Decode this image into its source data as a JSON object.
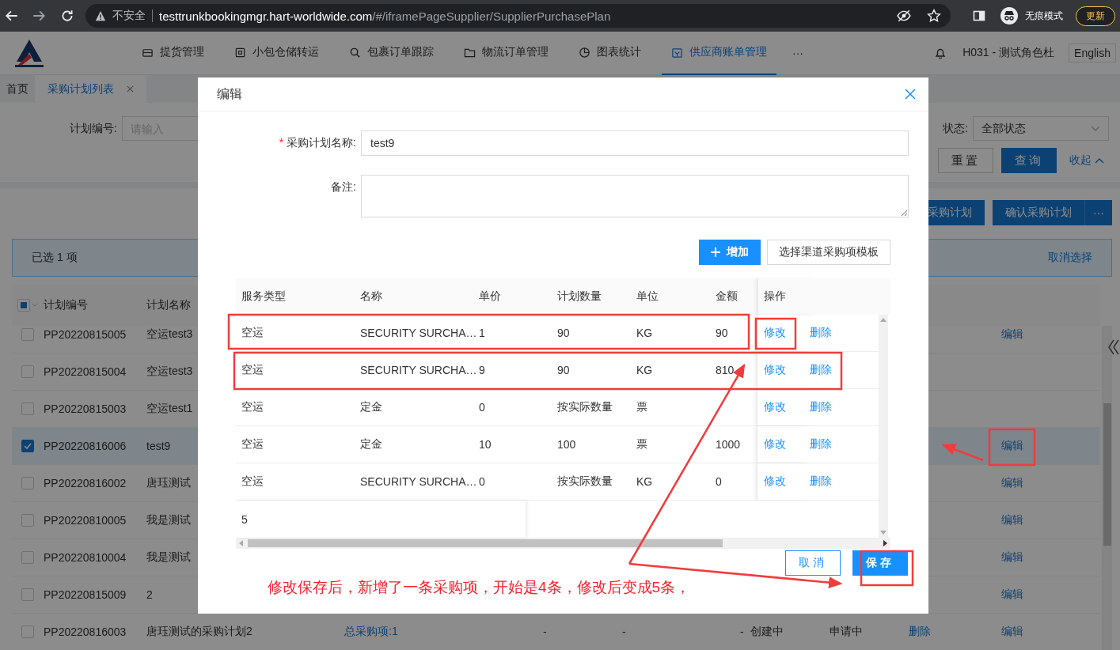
{
  "browser": {
    "security": "不安全",
    "url_host": "testtrunkbookingmgr.hart-worldwide.com",
    "url_path": "/#/iframePageSupplier/SupplierPurchasePlan",
    "profile": "无痕模式",
    "update_button": "更新"
  },
  "nav": {
    "items": [
      {
        "label": "提货管理",
        "selected": false
      },
      {
        "label": "小包仓储转运",
        "selected": false
      },
      {
        "label": "包裹订单跟踪",
        "selected": false
      },
      {
        "label": "物流订单管理",
        "selected": false
      },
      {
        "label": "图表统计",
        "selected": false
      },
      {
        "label": "供应商账单管理",
        "selected": true
      }
    ],
    "more": "···",
    "user": "H031 - 测试角色杜",
    "language": "English"
  },
  "tabs": [
    {
      "label": "首页",
      "selected": false,
      "closable": false
    },
    {
      "label": "采购计划列表",
      "selected": true,
      "closable": true
    }
  ],
  "filters": {
    "plan_no_label": "计划编号:",
    "plan_no_placeholder": "请输入",
    "status_label": "状态:",
    "status_value": "全部状态",
    "reset": "重置",
    "search": "查询",
    "collapse": "收起"
  },
  "actions": {
    "create": "采购计划",
    "confirm": "确认采购计划",
    "more": "···"
  },
  "selection": {
    "text": "已选 1 项",
    "clear": "取消选择"
  },
  "table": {
    "header_indeterminate": true,
    "columns": [
      "计划编号",
      "计划名称"
    ],
    "rows": [
      {
        "selected": false,
        "plan_no": "PP20220815005",
        "plan_name": "空运test3",
        "column_11": "编辑"
      },
      {
        "selected": false,
        "plan_no": "PP20220815004",
        "plan_name": "空运test3"
      },
      {
        "selected": false,
        "plan_no": "PP20220815003",
        "plan_name": "空运test1"
      },
      {
        "selected": true,
        "plan_no": "PP20220816006",
        "plan_name": "test9",
        "column_11": "编辑"
      },
      {
        "selected": false,
        "plan_no": "PP20220816002",
        "plan_name": "唐珏测试",
        "column_11": "编辑"
      },
      {
        "selected": false,
        "plan_no": "PP20220810005",
        "plan_name": "我是测试",
        "column_11": "编辑"
      },
      {
        "selected": false,
        "plan_no": "PP20220810004",
        "plan_name": "我是测试",
        "column_11": "编辑"
      },
      {
        "selected": false,
        "plan_no": "PP20220815009",
        "plan_name": "2",
        "column_11": "编辑"
      },
      {
        "selected": false,
        "plan_no": "PP20220816003",
        "plan_name": "唐珏测试的采购计划2",
        "column_4": "总采购项:1",
        "column_5": "-",
        "column_6": "-",
        "column_7": "-",
        "column_8": "创建中",
        "column_9": "申请中",
        "column_10": "删除",
        "column_11": "编辑"
      }
    ]
  },
  "modal": {
    "title": "编辑",
    "name_label": "采购计划名称:",
    "required_mark": "*",
    "name_value": "test9",
    "remark_label": "备注:",
    "add_button": "增加",
    "template_button": "选择渠道采购项模板",
    "columns": [
      "服务类型",
      "名称",
      "单价",
      "计划数量",
      "单位",
      "金额",
      "操作"
    ],
    "items": [
      {
        "service": "空运",
        "name": "SECURITY SURCHA…",
        "price": "1",
        "qty": "90",
        "unit": "KG",
        "amount": "90",
        "edit": "修改",
        "delete": "删除"
      },
      {
        "service": "空运",
        "name": "SECURITY SURCHA…",
        "price": "9",
        "qty": "90",
        "unit": "KG",
        "amount": "810",
        "edit": "修改",
        "delete": "删除"
      },
      {
        "service": "空运",
        "name": "定金",
        "price": "0",
        "qty": "按实际数量",
        "unit": "票",
        "edit": "修改",
        "delete": "删除"
      },
      {
        "service": "空运",
        "name": "定金",
        "price": "10",
        "qty": "100",
        "unit": "票",
        "amount": "1000",
        "edit": "修改",
        "delete": "删除"
      },
      {
        "service": "空运",
        "name": "SECURITY SURCHA…",
        "price": "0",
        "qty": "按实际数量",
        "unit": "KG",
        "amount": "0",
        "edit": "修改",
        "delete": "删除"
      }
    ],
    "total": "5",
    "cancel": "取消",
    "save": "保存"
  },
  "annotation": "修改保存后，新增了一条采购项，开始是4条，修改后变成5条，"
}
